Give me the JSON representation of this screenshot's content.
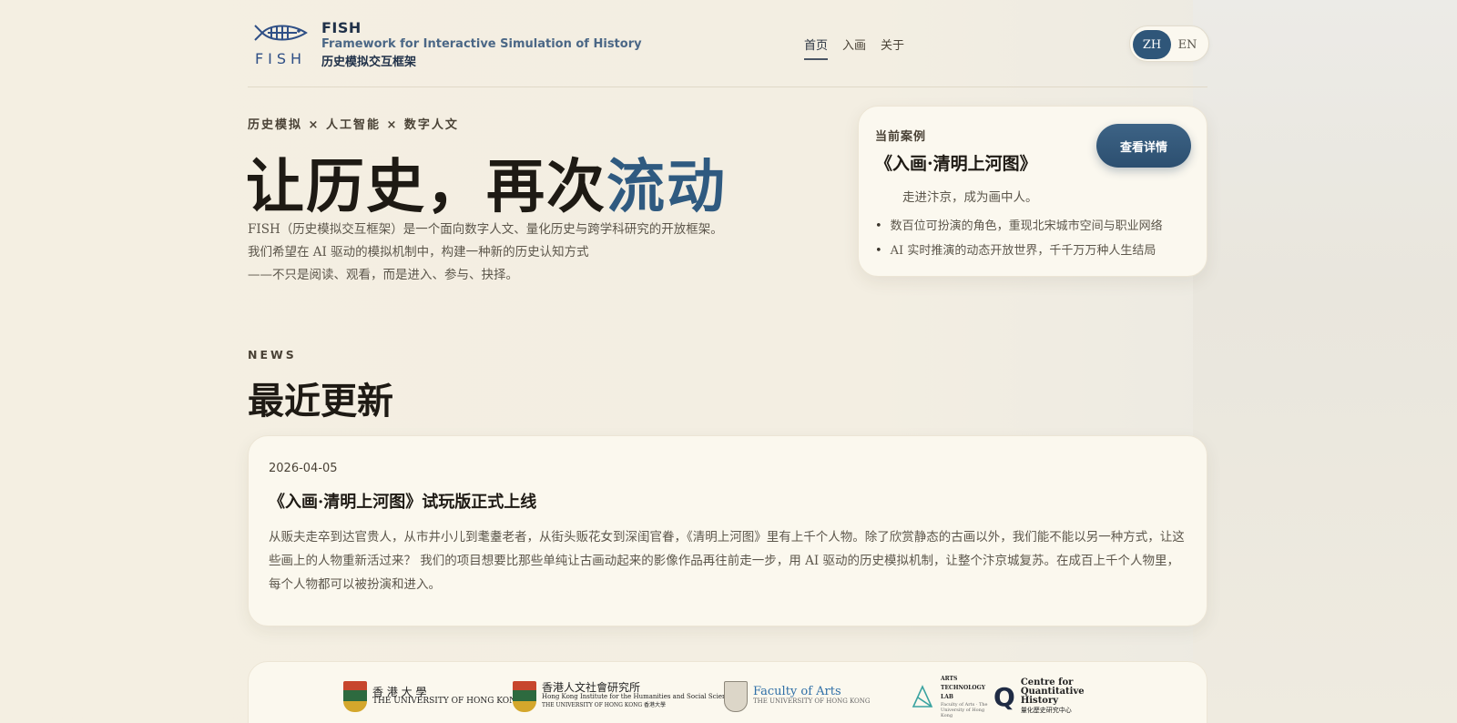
{
  "header": {
    "brand_name": "FISH",
    "brand_en": "Framework for Interactive Simulation of History",
    "brand_zh": "历史模拟交互框架",
    "logo_text": "FISH",
    "nav": [
      {
        "label": "首页",
        "active": true
      },
      {
        "label": "入画",
        "active": false
      },
      {
        "label": "关于",
        "active": false
      }
    ],
    "lang": {
      "zh": "ZH",
      "en": "EN",
      "selected": "ZH"
    }
  },
  "hero": {
    "eyebrow": "历史模拟 × 人工智能 × 数字人文",
    "title_main": "让历史，再次",
    "title_accent": "流动",
    "desc": [
      "FISH（历史模拟交互框架）是一个面向数字人文、量化历史与跨学科研究的开放框架。",
      "我们希望在 AI 驱动的模拟机制中，构建一种新的历史认知方式",
      "——不只是阅读、观看，而是进入、参与、抉择。"
    ]
  },
  "case": {
    "label": "当前案例",
    "title": "《入画·清明上河图》",
    "subtitle": "走进汴京，成为画中人。",
    "bullets": [
      "数百位可扮演的角色，重现北宋城市空间与职业网络",
      "AI 实时推演的动态开放世界，千千万万种人生结局"
    ],
    "button": "查看详情"
  },
  "news": {
    "eyebrow": "NEWS",
    "title": "最近更新",
    "items": [
      {
        "date": "2026-04-05",
        "headline": "《入画·清明上河图》试玩版正式上线",
        "body": "从贩夫走卒到达官贵人，从市井小儿到耄耋老者，从街头贩花女到深闺官眷，《清明上河图》里有上千个人物。除了欣赏静态的古画以外，我们能不能以另一种方式，让这些画上的人物重新活过来？ 我们的项目想要比那些单纯让古画动起来的影像作品再往前走一步，用 AI 驱动的历史模拟机制，让整个汴京城复苏。在成百上千个人物里，每个人物都可以被扮演和进入。"
      }
    ]
  },
  "partners": [
    {
      "name_zh": "香 港 大 學",
      "name_en": "THE UNIVERSITY OF HONG KONG"
    },
    {
      "name_zh": "香港人文社會研究所",
      "name_en": "Hong Kong Institute for the Humanities and Social Sciences",
      "name_sub": "THE UNIVERSITY OF HONG KONG 香港大學"
    },
    {
      "name_en": "Faculty of Arts",
      "name_sub": "THE UNIVERSITY OF HONG KONG"
    },
    {
      "name_en": "ARTS TECHNOLOGY LAB",
      "name_sub": "Faculty of Arts · The University of Hong Kong"
    },
    {
      "name_en": "Centre for Quantitative History",
      "name_zh": "量化歷史研究中心"
    }
  ],
  "colors": {
    "accent": "#2f5a80",
    "button": "#2f5679",
    "background": "#f4efe2",
    "card": "#fbf8ee"
  }
}
